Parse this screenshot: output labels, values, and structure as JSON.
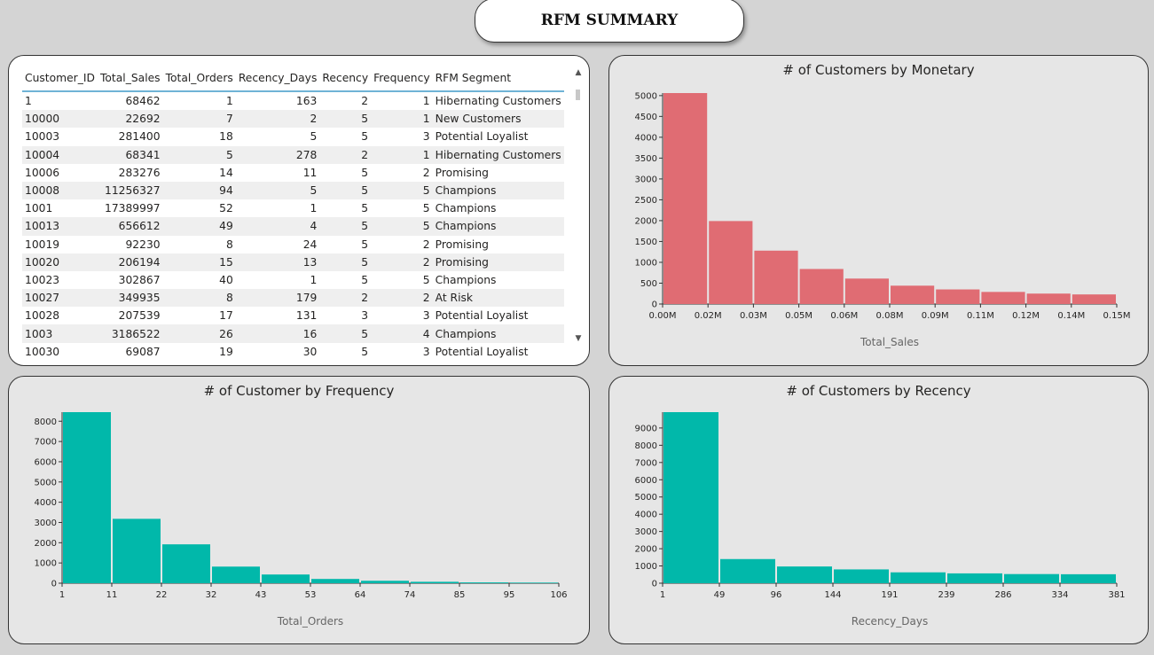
{
  "header": {
    "title": "RFM SUMMARY"
  },
  "table": {
    "columns": [
      "Customer_ID",
      "Total_Sales",
      "Total_Orders",
      "Recency_Days",
      "Recency",
      "Frequency",
      "RFM Segment"
    ],
    "rows": [
      [
        "1",
        "68462",
        "1",
        "163",
        "2",
        "1",
        "Hibernating Customers"
      ],
      [
        "10000",
        "22692",
        "7",
        "2",
        "5",
        "1",
        "New Customers"
      ],
      [
        "10003",
        "281400",
        "18",
        "5",
        "5",
        "3",
        "Potential Loyalist"
      ],
      [
        "10004",
        "68341",
        "5",
        "278",
        "2",
        "1",
        "Hibernating Customers"
      ],
      [
        "10006",
        "283276",
        "14",
        "11",
        "5",
        "2",
        "Promising"
      ],
      [
        "10008",
        "11256327",
        "94",
        "5",
        "5",
        "5",
        "Champions"
      ],
      [
        "1001",
        "17389997",
        "52",
        "1",
        "5",
        "5",
        "Champions"
      ],
      [
        "10013",
        "656612",
        "49",
        "4",
        "5",
        "5",
        "Champions"
      ],
      [
        "10019",
        "92230",
        "8",
        "24",
        "5",
        "2",
        "Promising"
      ],
      [
        "10020",
        "206194",
        "15",
        "13",
        "5",
        "2",
        "Promising"
      ],
      [
        "10023",
        "302867",
        "40",
        "1",
        "5",
        "5",
        "Champions"
      ],
      [
        "10027",
        "349935",
        "8",
        "179",
        "2",
        "2",
        "At Risk"
      ],
      [
        "10028",
        "207539",
        "17",
        "131",
        "3",
        "3",
        "Potential Loyalist"
      ],
      [
        "1003",
        "3186522",
        "26",
        "16",
        "5",
        "4",
        "Champions"
      ],
      [
        "10030",
        "69087",
        "19",
        "30",
        "5",
        "3",
        "Potential Loyalist"
      ]
    ],
    "scroll_up_icon": "▲",
    "scroll_down_icon": "▼"
  },
  "chart_data": [
    {
      "type": "bar",
      "title": "# of Customers by Monetary",
      "xlabel": "Total_Sales",
      "ylabel": "",
      "color": "#e06c73",
      "ylim": [
        0,
        5000
      ],
      "yticks": [
        0,
        500,
        1000,
        1500,
        2000,
        2500,
        3000,
        3500,
        4000,
        4500,
        5000
      ],
      "xticks": [
        "0.00M",
        "0.02M",
        "0.03M",
        "0.05M",
        "0.06M",
        "0.08M",
        "0.09M",
        "0.11M",
        "0.12M",
        "0.14M",
        "0.15M"
      ],
      "values": [
        5060,
        1990,
        1280,
        840,
        610,
        440,
        350,
        290,
        250,
        230
      ]
    },
    {
      "type": "bar",
      "title": "# of Customer by Frequency",
      "xlabel": "Total_Orders",
      "ylabel": "",
      "color": "#01b8aa",
      "ylim": [
        0,
        8000
      ],
      "yticks": [
        0,
        1000,
        2000,
        3000,
        4000,
        5000,
        6000,
        7000,
        8000
      ],
      "xticks": [
        "1",
        "11",
        "22",
        "32",
        "43",
        "53",
        "64",
        "74",
        "85",
        "95",
        "106"
      ],
      "values": [
        8450,
        3180,
        1920,
        820,
        430,
        210,
        120,
        70,
        40,
        30
      ]
    },
    {
      "type": "bar",
      "title": "# of Customers by Recency",
      "xlabel": "Recency_Days",
      "ylabel": "",
      "color": "#01b8aa",
      "ylim": [
        0,
        9000
      ],
      "yticks": [
        0,
        1000,
        2000,
        3000,
        4000,
        5000,
        6000,
        7000,
        8000,
        9000
      ],
      "xticks": [
        "1",
        "49",
        "96",
        "144",
        "191",
        "239",
        "286",
        "334",
        "381"
      ],
      "values": [
        9920,
        1400,
        970,
        800,
        630,
        570,
        530,
        520
      ]
    }
  ]
}
